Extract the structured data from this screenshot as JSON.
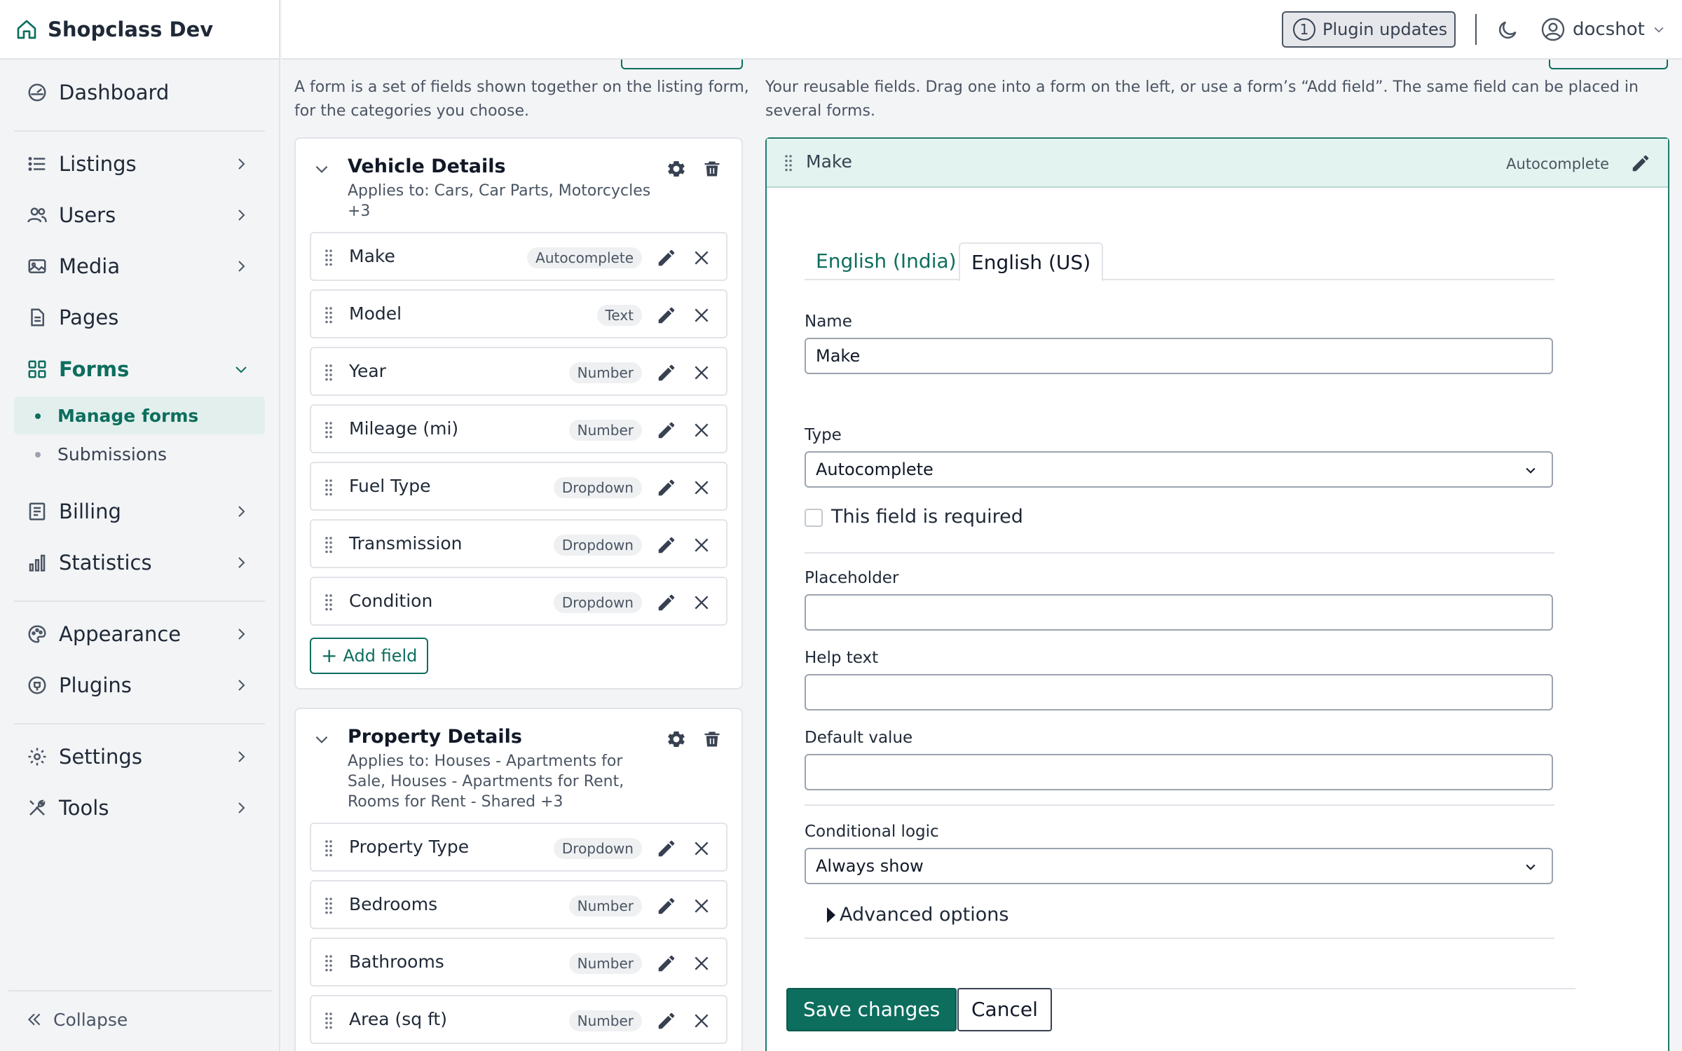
{
  "app": {
    "title": "Shopclass Dev"
  },
  "colors": {
    "accent": "#0d6e5e",
    "accent_light": "#e3f3ef",
    "border": "#e1e4e8"
  },
  "sidebar": {
    "items": [
      {
        "label": "Dashboard",
        "icon": "dashboard-icon"
      },
      {
        "label": "Listings",
        "icon": "list-icon"
      },
      {
        "label": "Users",
        "icon": "users-icon"
      },
      {
        "label": "Media",
        "icon": "media-icon"
      },
      {
        "label": "Pages",
        "icon": "page-icon"
      },
      {
        "label": "Forms",
        "icon": "forms-icon",
        "active": true
      },
      {
        "label": "Billing",
        "icon": "billing-icon"
      },
      {
        "label": "Statistics",
        "icon": "statistics-icon"
      },
      {
        "label": "Appearance",
        "icon": "appearance-icon"
      },
      {
        "label": "Plugins",
        "icon": "plugins-icon"
      },
      {
        "label": "Settings",
        "icon": "settings-icon"
      },
      {
        "label": "Tools",
        "icon": "tools-icon"
      }
    ],
    "forms_sub": [
      {
        "label": "Manage forms",
        "active": true
      },
      {
        "label": "Submissions"
      }
    ],
    "collapse_label": "Collapse"
  },
  "topbar": {
    "plugin_updates_count": "1",
    "plugin_updates_label": "Plugin updates",
    "username": "docshot"
  },
  "left": {
    "description": "A form is a set of fields shown together on the listing form, for the categories you choose.",
    "forms": [
      {
        "title": "Vehicle Details",
        "applies": "Applies to: Cars, Car Parts, Motorcycles +3",
        "fields": [
          {
            "name": "Make",
            "type": "Autocomplete"
          },
          {
            "name": "Model",
            "type": "Text"
          },
          {
            "name": "Year",
            "type": "Number"
          },
          {
            "name": "Mileage (mi)",
            "type": "Number"
          },
          {
            "name": "Fuel Type",
            "type": "Dropdown"
          },
          {
            "name": "Transmission",
            "type": "Dropdown"
          },
          {
            "name": "Condition",
            "type": "Dropdown"
          }
        ],
        "add_label": "Add field"
      },
      {
        "title": "Property Details",
        "applies": "Applies to: Houses - Apartments for Sale, Houses - Apartments for Rent, Rooms for Rent - Shared +3",
        "fields": [
          {
            "name": "Property Type",
            "type": "Dropdown"
          },
          {
            "name": "Bedrooms",
            "type": "Number"
          },
          {
            "name": "Bathrooms",
            "type": "Number"
          },
          {
            "name": "Area (sq ft)",
            "type": "Number"
          }
        ]
      }
    ]
  },
  "right": {
    "description": "Your reusable fields. Drag one into a form on the left, or use a form’s “Add field”. The same field can be placed in several forms.",
    "field": {
      "name": "Make",
      "type": "Autocomplete"
    },
    "tabs": [
      "English (India)",
      "English (US)"
    ],
    "active_tab": "English (US)",
    "name_label": "Name",
    "name_value": "Make",
    "type_label": "Type",
    "type_value": "Autocomplete",
    "required_label": "This field is required",
    "placeholder_label": "Placeholder",
    "placeholder_value": "",
    "help_label": "Help text",
    "help_value": "",
    "default_label": "Default value",
    "default_value": "",
    "conditional_label": "Conditional logic",
    "conditional_value": "Always show",
    "advanced_label": "Advanced options",
    "save_label": "Save changes",
    "cancel_label": "Cancel"
  }
}
